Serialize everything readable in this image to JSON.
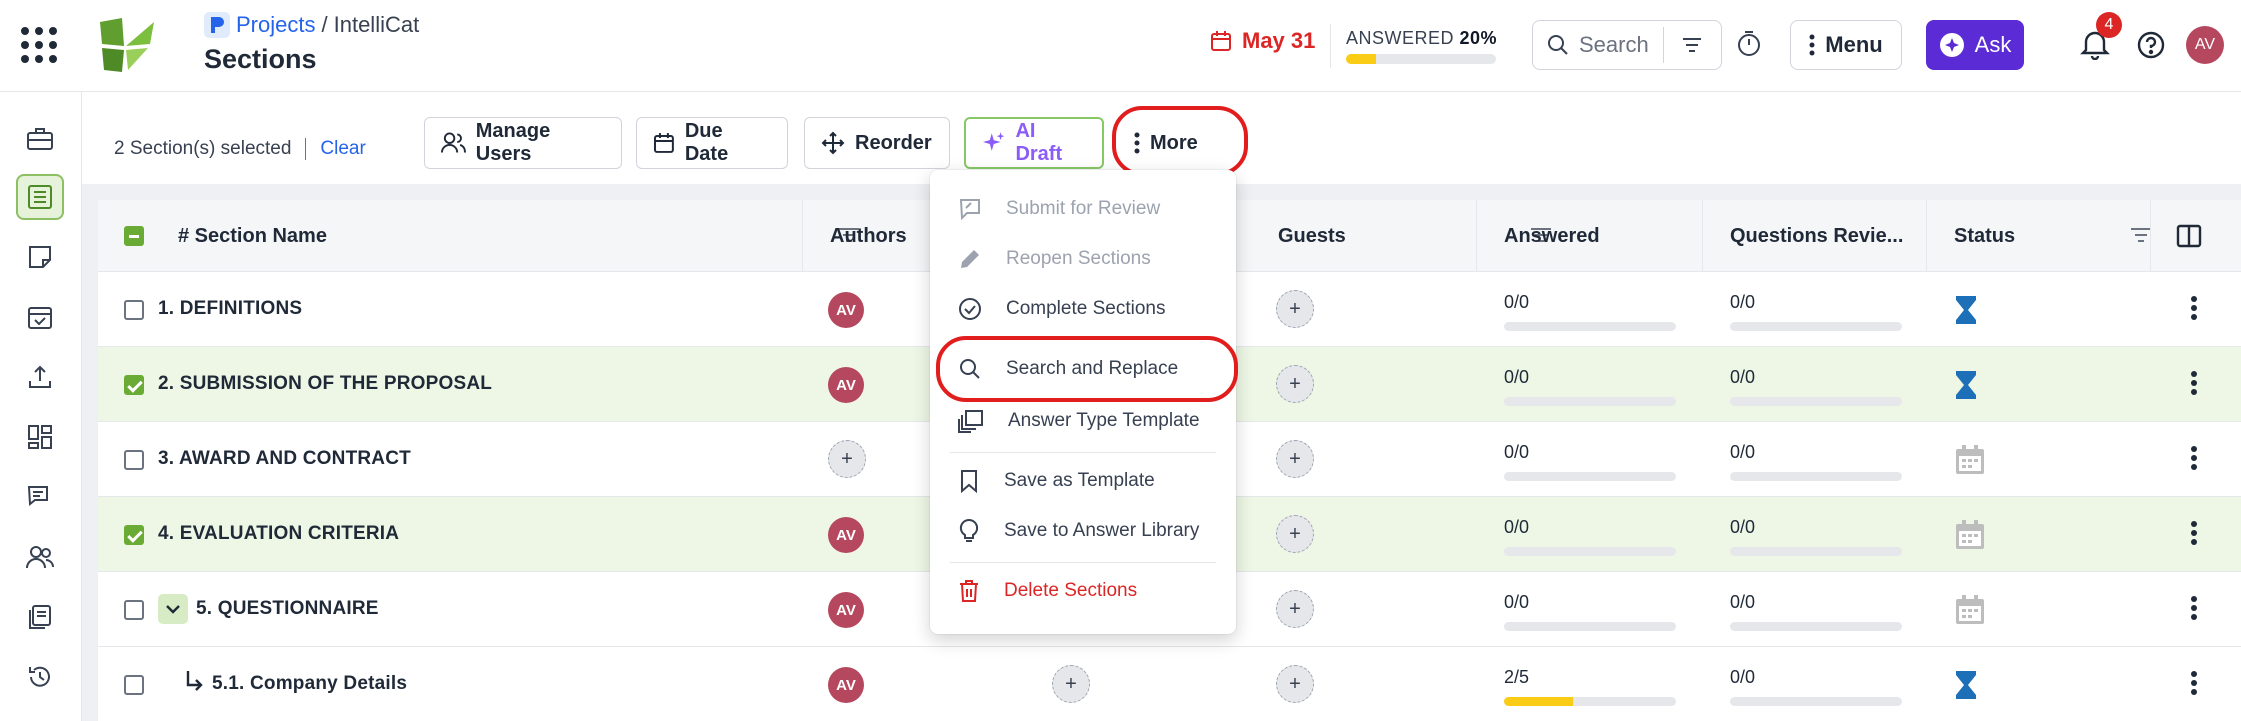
{
  "header": {
    "breadcrumb_projects": "Projects",
    "breadcrumb_sep": "/",
    "breadcrumb_current": "IntelliCat",
    "page_title": "Sections",
    "due_date": "May 31",
    "answered_label": "ANSWERED",
    "answered_percent": "20%",
    "answered_fraction": 0.2,
    "search_placeholder": "Search",
    "menu_label": "Menu",
    "ask_label": "Ask",
    "notification_count": "4",
    "user_initials": "AV"
  },
  "toolbar": {
    "selected_text": "2 Section(s) selected",
    "clear_label": "Clear",
    "manage_users": "Manage Users",
    "due_date": "Due Date",
    "reorder": "Reorder",
    "ai_draft": "AI Draft",
    "more": "More"
  },
  "table": {
    "columns": [
      "# Section Name",
      "Authors",
      "Guests",
      "Answered",
      "Questions Revie...",
      "Status"
    ],
    "rows": [
      {
        "name": "1. DEFINITIONS",
        "checked": false,
        "author": "AV",
        "answered": "0/0",
        "answered_fraction": 0,
        "reviewed": "0/0",
        "status": "hourglass"
      },
      {
        "name": "2. SUBMISSION OF THE PROPOSAL",
        "checked": true,
        "author": "AV",
        "answered": "0/0",
        "answered_fraction": 0,
        "reviewed": "0/0",
        "status": "hourglass"
      },
      {
        "name": "3. AWARD AND CONTRACT",
        "checked": false,
        "author": "",
        "answered": "0/0",
        "answered_fraction": 0,
        "reviewed": "0/0",
        "status": "calendar"
      },
      {
        "name": "4. EVALUATION CRITERIA",
        "checked": true,
        "author": "AV",
        "answered": "0/0",
        "answered_fraction": 0,
        "reviewed": "0/0",
        "status": "calendar"
      },
      {
        "name": "5. QUESTIONNAIRE",
        "checked": false,
        "author": "AV",
        "answered": "0/0",
        "answered_fraction": 0,
        "reviewed": "0/0",
        "status": "calendar"
      },
      {
        "name": "5.1. Company Details",
        "checked": false,
        "author": "AV",
        "answered": "2/5",
        "answered_fraction": 0.4,
        "reviewed": "0/0",
        "status": "hourglass"
      }
    ]
  },
  "dropdown": {
    "items": [
      {
        "label": "Submit for Review",
        "icon": "submit-review-icon",
        "disabled": true
      },
      {
        "label": "Reopen Sections",
        "icon": "pencil-icon",
        "disabled": true
      },
      {
        "label": "Complete Sections",
        "icon": "check-circle-icon",
        "disabled": false
      },
      {
        "label": "Search and Replace",
        "icon": "search-icon",
        "disabled": false
      },
      {
        "label": "Answer Type Template",
        "icon": "copy-icon",
        "disabled": false
      },
      {
        "label": "Save as Template",
        "icon": "bookmark-icon",
        "disabled": false
      },
      {
        "label": "Save to Answer Library",
        "icon": "lightbulb-icon",
        "disabled": false
      },
      {
        "label": "Delete Sections",
        "icon": "trash-icon",
        "disabled": false
      }
    ]
  },
  "colors": {
    "accent_green": "#6aab35",
    "brand_purple": "#5b2bd6",
    "danger_red": "#dc2626",
    "link_blue": "#2563eb",
    "highlight_ring": "#e11d1d"
  }
}
